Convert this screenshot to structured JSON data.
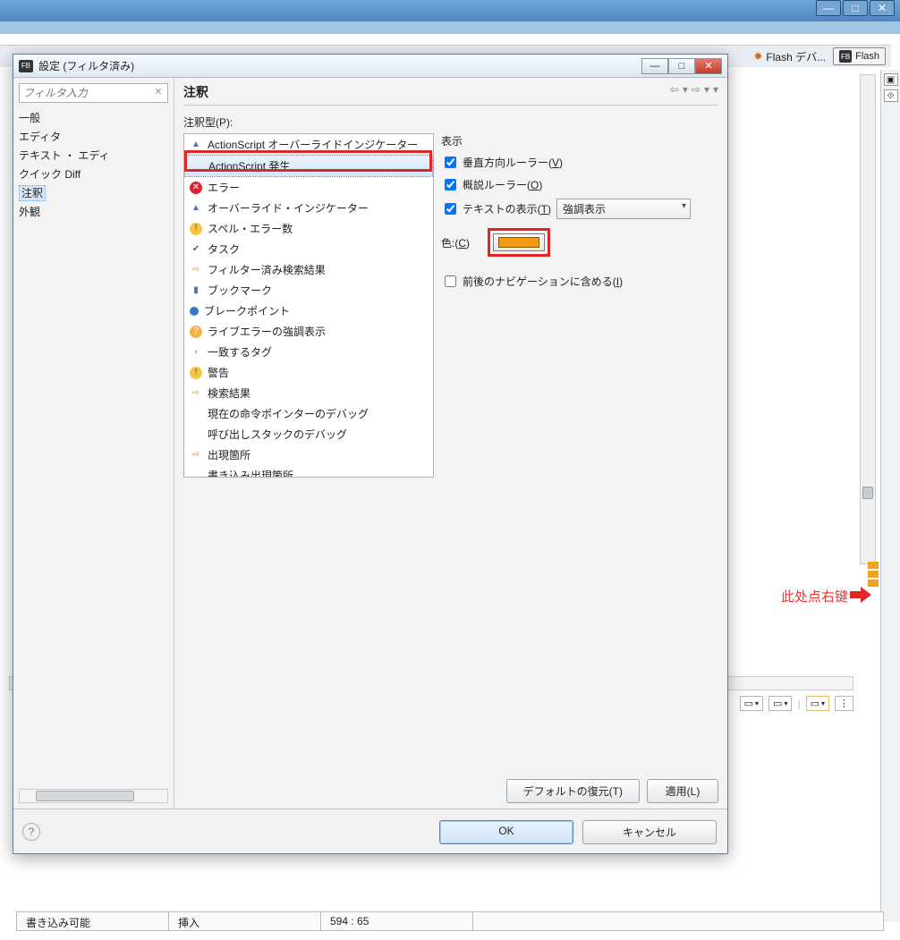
{
  "os": {
    "min": "—",
    "max": "□",
    "close": "✕"
  },
  "tabs": {
    "debug": "Flash デバ...",
    "flash": "Flash"
  },
  "right_gutter": {
    "a": "▣",
    "b": "⟐"
  },
  "callout": "此处点右键",
  "statusbar": {
    "a": "書き込み可能",
    "b": "挿入",
    "c": "594 : 65"
  },
  "dialog": {
    "title": "設定 (フィルタ済み)",
    "header": "注釈",
    "filter_placeholder": "フィルタ入力",
    "nav": {
      "general": "一般",
      "editor": "エディタ",
      "text": "テキスト ・ エディ",
      "quickdiff": "クイック Diff",
      "annotations": "注釈",
      "appearance": "外観"
    },
    "annotation_types_label": "注釈型(P):",
    "list": [
      {
        "ico": "ovr",
        "label": "ActionScript オーバーライドインジケーター"
      },
      {
        "ico": "sel",
        "label": "ActionScript 発生"
      },
      {
        "ico": "xerr",
        "label": "エラー"
      },
      {
        "ico": "aov",
        "label": "オーバーライド・インジケーター"
      },
      {
        "ico": "warn",
        "label": "スペル・エラー数"
      },
      {
        "ico": "task",
        "label": "タスク"
      },
      {
        "ico": "filt",
        "label": "フィルター済み検索結果"
      },
      {
        "ico": "bmk",
        "label": "ブックマーク"
      },
      {
        "ico": "bp",
        "label": "ブレークポイント"
      },
      {
        "ico": "qmk",
        "label": "ライブエラーの強調表示"
      },
      {
        "ico": "aov",
        "label": "一致するタグ"
      },
      {
        "ico": "warn",
        "label": "警告"
      },
      {
        "ico": "filt",
        "label": "検索結果"
      },
      {
        "ico": "none",
        "label": "現在の命令ポインターのデバッグ"
      },
      {
        "ico": "none",
        "label": "呼び出しスタックのデバッグ"
      },
      {
        "ico": "filt",
        "label": "出現箇所"
      },
      {
        "ico": "none",
        "label": "書き込み出現箇所"
      }
    ],
    "options": {
      "display_group": "表示",
      "vertical_ruler": "垂直方向ルーラー(V)",
      "overview_ruler": "概説ルーラー(O)",
      "text_as": "テキストの表示(T)",
      "text_as_value": "強調表示",
      "color_label": "色:(C)",
      "color_value": "#f59a10",
      "include_nav": "前後のナビゲーションに含める(I)"
    },
    "buttons": {
      "restore": "デフォルトの復元(T)",
      "apply": "適用(L)",
      "ok": "OK",
      "cancel": "キャンセル"
    }
  }
}
